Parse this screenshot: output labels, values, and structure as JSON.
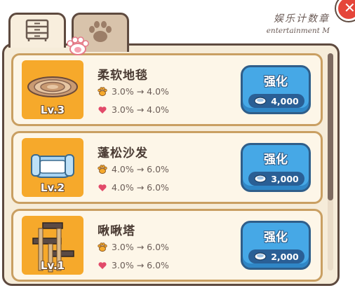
{
  "tabs": [
    {
      "icon": "drawer-cabinet-icon",
      "active": true
    },
    {
      "icon": "paw-icon",
      "active": false
    }
  ],
  "watermark": {
    "line1": "娱乐计数章",
    "line2": "entertainment M"
  },
  "items": [
    {
      "name": "柔软地毯",
      "level": "Lv.3",
      "icon": "rug-icon",
      "stat1": "3.0% → 4.0%",
      "stat2": "3.0% → 4.0%",
      "button": "强化",
      "cost": "4,000"
    },
    {
      "name": "蓬松沙发",
      "level": "Lv.2",
      "icon": "cat-bed-icon",
      "stat1": "4.0% → 6.0%",
      "stat2": "4.0% → 6.0%",
      "button": "强化",
      "cost": "3,000"
    },
    {
      "name": "啾啾塔",
      "level": "Lv.1",
      "icon": "cat-tower-icon",
      "stat1": "3.0% → 6.0%",
      "stat2": "3.0% → 6.0%",
      "button": "强化",
      "cost": "2,000"
    }
  ],
  "colors": {
    "accent_orange": "#f6a92b",
    "button_blue": "#46a8e6",
    "frame_brown": "#5e4a3f"
  }
}
